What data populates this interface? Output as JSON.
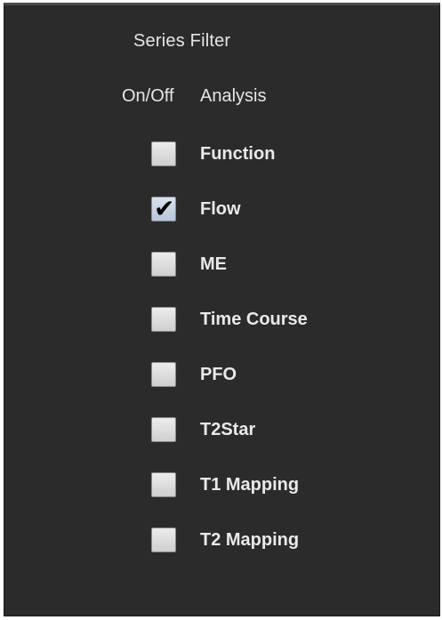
{
  "title": "Series Filter",
  "header": {
    "onoff": "On/Off",
    "analysis": "Analysis"
  },
  "items": [
    {
      "label": "Function",
      "checked": false
    },
    {
      "label": "Flow",
      "checked": true
    },
    {
      "label": "ME",
      "checked": false
    },
    {
      "label": "Time Course",
      "checked": false
    },
    {
      "label": "PFO",
      "checked": false
    },
    {
      "label": "T2Star",
      "checked": false
    },
    {
      "label": "T1 Mapping",
      "checked": false
    },
    {
      "label": "T2 Mapping",
      "checked": false
    }
  ],
  "colors": {
    "panel_bg": "#2b2b2b",
    "text": "#e6e6e6"
  }
}
